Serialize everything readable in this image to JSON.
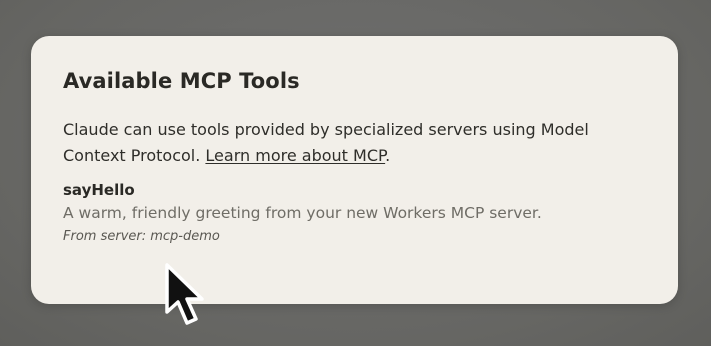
{
  "dialog": {
    "title": "Available MCP Tools",
    "description_text": "Claude can use tools provided by specialized servers using Model Context Protocol. ",
    "learn_more_link": "Learn more about MCP",
    "description_end": "."
  },
  "tools": [
    {
      "name": "sayHello",
      "description": "A warm, friendly greeting from your new Workers MCP server.",
      "server_label": "From server: mcp-demo"
    }
  ],
  "cursor": {
    "icon": "arrow-pointer-icon"
  }
}
